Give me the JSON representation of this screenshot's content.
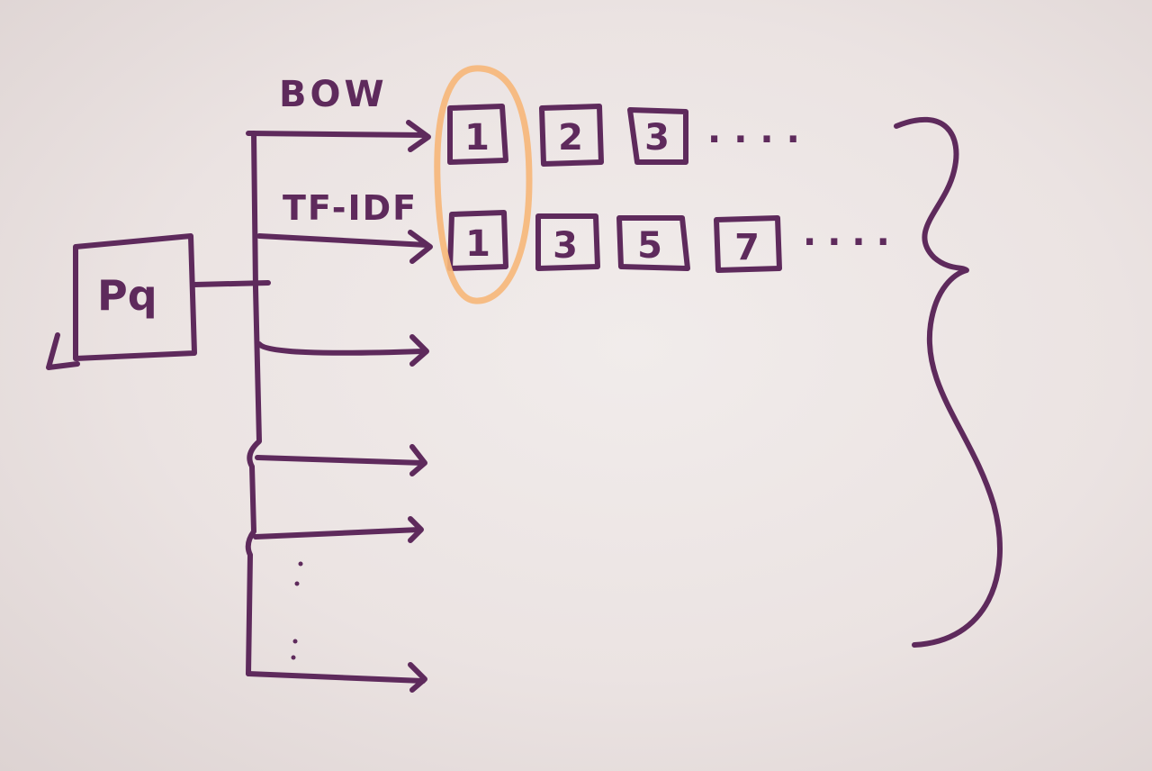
{
  "query_box": {
    "label": "Pq"
  },
  "bow": {
    "label": "BOW",
    "results": [
      "1",
      "2",
      "3"
    ],
    "ellipsis": "...."
  },
  "tfidf": {
    "label": "TF-IDF",
    "results": [
      "1",
      "3",
      "5",
      "7"
    ],
    "ellipsis": "...."
  },
  "colors": {
    "ink": "#5e2a5c",
    "highlight": "#f6b77b",
    "paper": "#ebe4e3"
  }
}
